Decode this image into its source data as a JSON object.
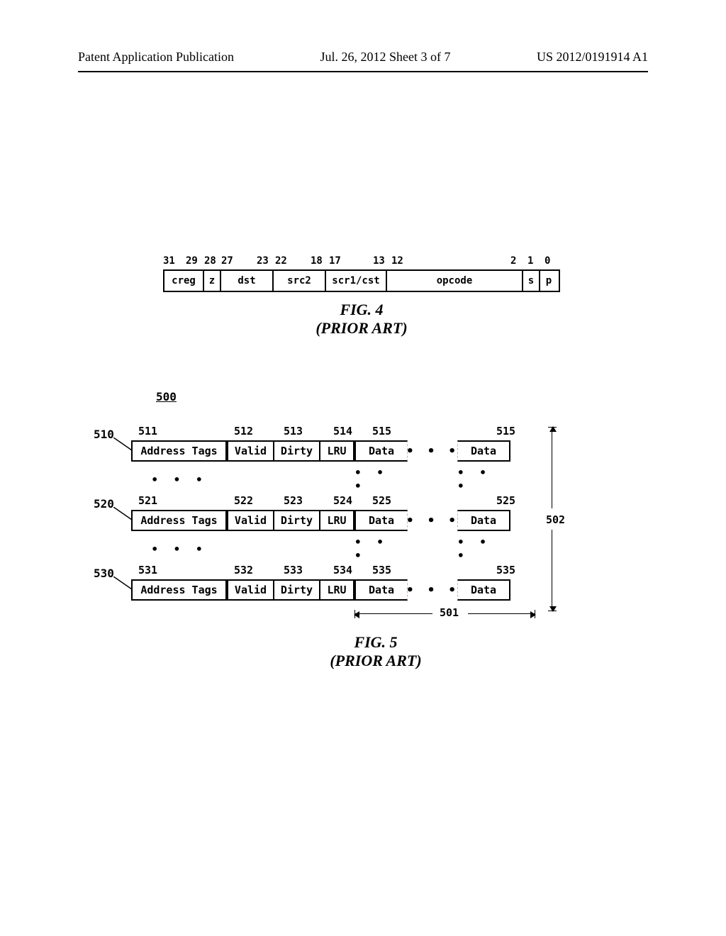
{
  "header": {
    "left": "Patent Application Publication",
    "center": "Jul. 26, 2012  Sheet 3 of 7",
    "right": "US 2012/0191914 A1"
  },
  "fig4": {
    "bit_labels": [
      "31",
      "29",
      "28",
      "27",
      "23",
      "22",
      "18",
      "17",
      "13",
      "12",
      "2",
      "1",
      "0"
    ],
    "fields": {
      "creg": "creg",
      "z": "z",
      "dst": "dst",
      "src2": "src2",
      "src1cst": "scr1/cst",
      "opcode": "opcode",
      "s": "s",
      "p": "p"
    },
    "caption_line1": "FIG. 4",
    "caption_line2": "(PRIOR ART)"
  },
  "fig5": {
    "ref": "500",
    "rows": [
      {
        "pointer": "510",
        "cols": {
          "c511": "511",
          "c512": "512",
          "c513": "513",
          "c514": "514",
          "c515": "515",
          "c515b": "515"
        },
        "cells": {
          "addr": "Address Tags",
          "valid": "Valid",
          "dirty": "Dirty",
          "lru": "LRU",
          "data": "Data",
          "data2": "Data"
        }
      },
      {
        "pointer": "520",
        "cols": {
          "c521": "521",
          "c522": "522",
          "c523": "523",
          "c524": "524",
          "c525": "525",
          "c525b": "525"
        },
        "cells": {
          "addr": "Address Tags",
          "valid": "Valid",
          "dirty": "Dirty",
          "lru": "LRU",
          "data": "Data",
          "data2": "Data"
        }
      },
      {
        "pointer": "530",
        "cols": {
          "c531": "531",
          "c532": "532",
          "c533": "533",
          "c534": "534",
          "c535": "535",
          "c535b": "535"
        },
        "cells": {
          "addr": "Address Tags",
          "valid": "Valid",
          "dirty": "Dirty",
          "lru": "LRU",
          "data": "Data",
          "data2": "Data"
        }
      }
    ],
    "ref501": "501",
    "ref502": "502",
    "caption_line1": "FIG. 5",
    "caption_line2": "(PRIOR ART)"
  }
}
